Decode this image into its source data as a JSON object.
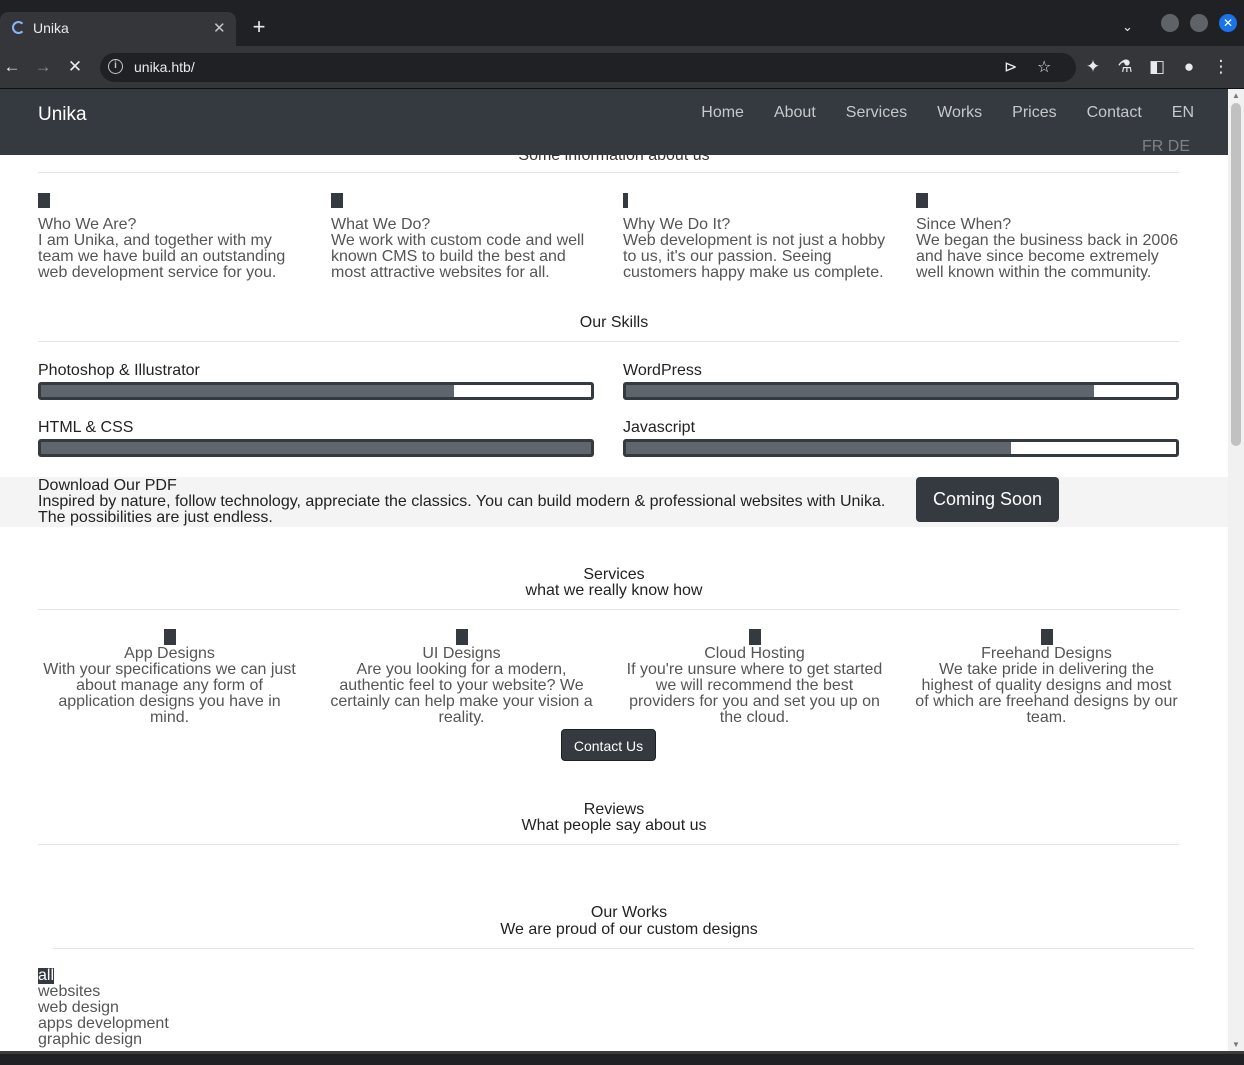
{
  "browser": {
    "tab_title": "Unika",
    "url": "unika.htb/",
    "icons": {
      "back": "arrow-left-icon",
      "forward": "arrow-right-icon",
      "stop": "close-icon",
      "info": "info-icon",
      "send": "send-icon",
      "star": "star-icon",
      "extensions": "puzzle-icon",
      "labs": "flask-icon",
      "sidepanel": "sidepanel-icon",
      "profile": "person-icon",
      "menu": "kebab-menu-icon"
    }
  },
  "nav": {
    "brand": "Unika",
    "links": [
      "Home",
      "About",
      "Services",
      "Works",
      "Prices",
      "Contact",
      "EN"
    ],
    "lang_others": "FR DE"
  },
  "about": {
    "clipped_heading": "Some information about us",
    "items": [
      {
        "title": "Who We Are?",
        "text": "I am Unika, and together with my team we have build an outstanding web development service for you."
      },
      {
        "title": "What We Do?",
        "text": "We work with custom code and well known CMS to build the best and most attractive websites for all."
      },
      {
        "title": "Why We Do It?",
        "text": "Web development is not just a hobby to us, it's our passion. Seeing customers happy make us complete."
      },
      {
        "title": "Since When?",
        "text": "We began the business back in 2006 and have since become extremely well known within the community."
      }
    ]
  },
  "skills": {
    "heading": "Our Skills",
    "items": [
      {
        "label": "Photoshop & Illustrator",
        "percent": 75
      },
      {
        "label": "WordPress",
        "percent": 85
      },
      {
        "label": "HTML & CSS",
        "percent": 100
      },
      {
        "label": "Javascript",
        "percent": 70
      }
    ]
  },
  "pdf": {
    "title": "Download Our PDF",
    "text": "Inspired by nature, follow technology, appreciate the classics. You can build modern & professional websites with Unika. The possibilities are just endless.",
    "button": "Coming Soon"
  },
  "services": {
    "heading": "Services",
    "subheading": "what we really know how",
    "items": [
      {
        "title": "App Designs",
        "text": "With your specifications we can just about manage any form of application designs you have in mind."
      },
      {
        "title": "UI Designs",
        "text": "Are you looking for a modern, authentic feel to your website? We certainly can help make your vision a reality."
      },
      {
        "title": "Cloud Hosting",
        "text": "If you're unsure where to get started we will recommend the best providers for you and set you up on the cloud."
      },
      {
        "title": "Freehand Designs",
        "text": "We take pride in delivering the highest of quality designs and most of which are freehand designs by our team."
      }
    ],
    "contact_button": "Contact Us"
  },
  "reviews": {
    "heading": "Reviews",
    "subheading": "What people say about us"
  },
  "works": {
    "heading": "Our Works",
    "subheading": "We are proud of our custom designs",
    "filters": [
      "all",
      "websites",
      "web design",
      "apps development",
      "graphic design"
    ],
    "active_filter": "all"
  }
}
